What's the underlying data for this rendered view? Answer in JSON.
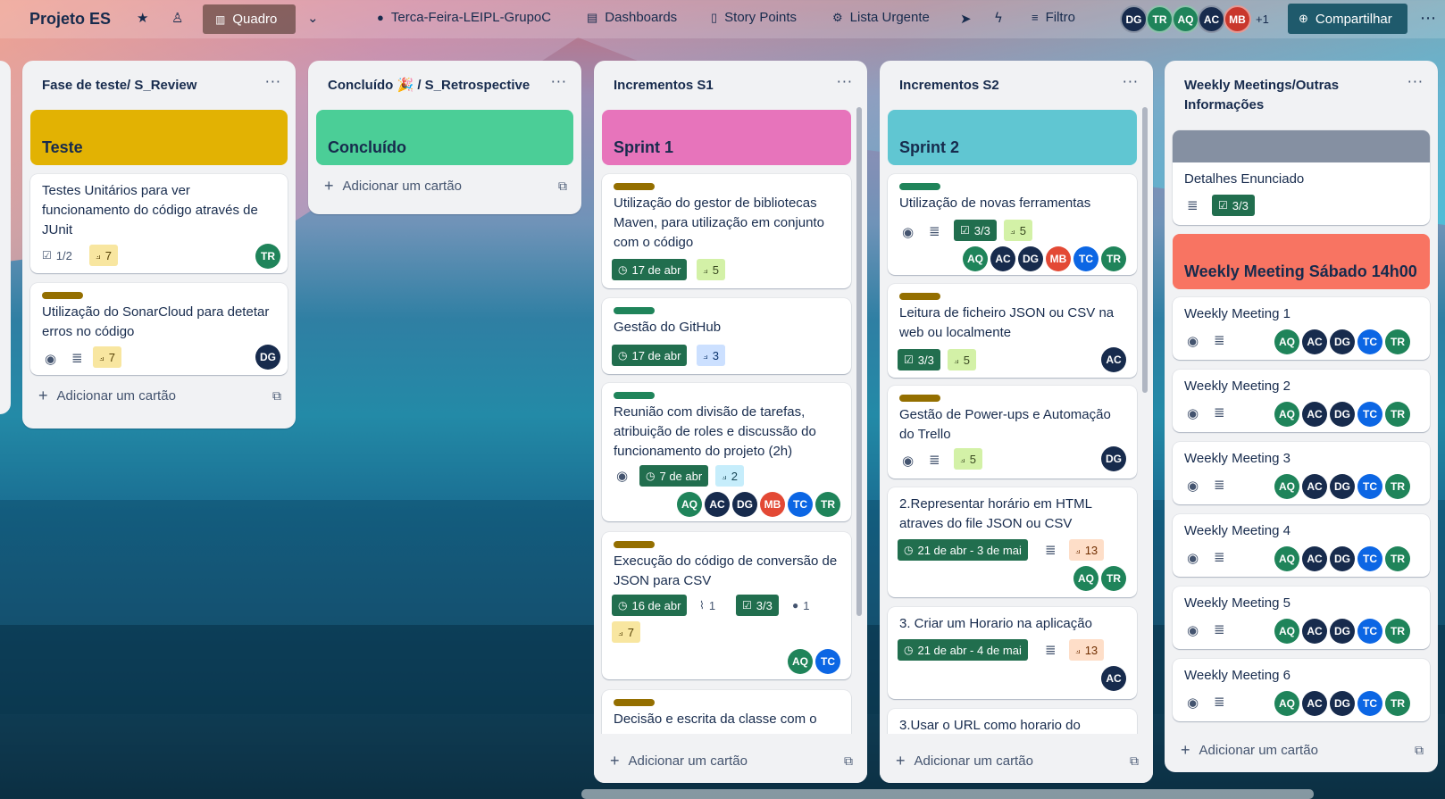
{
  "header": {
    "board_title": "Projeto ES",
    "view_label": "Quadro",
    "powerups": [
      {
        "label": "Terca-Feira-LEIPL-GrupoC",
        "icon": "github-icon"
      },
      {
        "label": "Dashboards",
        "icon": "dashboard-icon"
      },
      {
        "label": "Story Points",
        "icon": "story-points-icon"
      },
      {
        "label": "Lista Urgente",
        "icon": "gears-icon"
      }
    ],
    "filter_label": "Filtro",
    "members": [
      {
        "initials": "DG",
        "color": "#172b4d"
      },
      {
        "initials": "TR",
        "color": "#1f845a"
      },
      {
        "initials": "AQ",
        "color": "#1f845a"
      },
      {
        "initials": "AC",
        "color": "#172b4d"
      },
      {
        "initials": "MB",
        "color": "#c9372c"
      }
    ],
    "members_more": "+1",
    "share_label": "Compartilhar"
  },
  "colors": {
    "avatar_dark": "#172b4d",
    "avatar_green": "#1f845a",
    "avatar_red": "#e34935",
    "avatar_blue": "#0c66e4",
    "label_green": "#1f845a",
    "label_yellow": "#946f00"
  },
  "lists": [
    {
      "title": "Fase de teste/ S_Review",
      "add_label": "Adicionar um cartão",
      "cover": {
        "title": "Teste",
        "color": "#e2b203"
      },
      "cards": [
        {
          "title": "Testes Unitários para ver funcionamento do código através de JUnit",
          "checklist": "1/2",
          "points": "7",
          "members": [
            "TR"
          ]
        },
        {
          "title": "Utilização do SonarCloud para detetar erros no código",
          "label": "yellow",
          "points": "7",
          "members": [
            "DG"
          ]
        }
      ]
    },
    {
      "title": "Concluído 🎉 / S_Retrospective",
      "add_label": "Adicionar um cartão",
      "cover": {
        "title": "Concluído",
        "color": "#4bce97"
      }
    },
    {
      "title": "Incrementos S1",
      "add_label": "Adicionar um cartão",
      "cover": {
        "title": "Sprint 1",
        "color": "#e774bb"
      },
      "cards": [
        {
          "title": "Utilização do gestor de bibliotecas Maven, para utilização em conjunto com o código",
          "label": "yellow",
          "date": "17 de abr",
          "points": "5"
        },
        {
          "title": "Gestão do GitHub",
          "label": "green",
          "date": "17 de abr",
          "points": "3"
        },
        {
          "title": "Reunião com divisão de tarefas, atribuição de roles e discussão do funcionamento do projeto (2h)",
          "label": "green",
          "date": "7 de abr",
          "points": "2",
          "members": [
            "AQ",
            "AC",
            "DG",
            "MB",
            "TC",
            "TR"
          ]
        },
        {
          "title": "Execução do código de conversão de JSON para CSV",
          "label": "yellow",
          "date": "16 de abr",
          "attachments": "1",
          "checklist": "3/3",
          "github": "1",
          "points": "7",
          "members": [
            "AQ",
            "TC"
          ]
        },
        {
          "title": "Decisão e escrita da classe com o",
          "label": "yellow"
        }
      ]
    },
    {
      "title": "Incrementos S2",
      "add_label": "Adicionar um cartão",
      "cover": {
        "title": "Sprint 2",
        "color": "#60c6d2"
      },
      "cards": [
        {
          "title": "Utilização de novas ferramentas",
          "label": "green",
          "checklist": "3/3",
          "points": "5",
          "members": [
            "AQ",
            "AC",
            "DG",
            "MB",
            "TC",
            "TR"
          ]
        },
        {
          "title": "Leitura de ficheiro JSON ou CSV na web ou localmente",
          "label": "yellow",
          "checklist": "3/3",
          "points": "5",
          "members": [
            "AC"
          ]
        },
        {
          "title": "Gestão de Power-ups e Automação do Trello",
          "label": "yellow",
          "points": "5",
          "members": [
            "DG"
          ]
        },
        {
          "title": "2.Representar horário em HTML atraves do file JSON ou CSV",
          "date": "21 de abr - 3 de mai",
          "points": "13",
          "members": [
            "AQ",
            "TR"
          ]
        },
        {
          "title": "3. Criar um Horario na aplicação",
          "date": "21 de abr - 4 de mai",
          "points": "13",
          "members": [
            "AC"
          ]
        },
        {
          "title": "3.Usar o URL como horario do"
        }
      ]
    },
    {
      "title": "Weekly Meetings/Outras Informações",
      "add_label": "Adicionar um cartão",
      "cards": [
        {
          "title": "Detalhes Enunciado",
          "cover_color": "#8590a2",
          "checklist": "3/3"
        },
        {
          "title": "Weekly Meeting Sábado 14h00",
          "cover_color": "#f87462"
        },
        {
          "title": "Weekly Meeting 1",
          "members": [
            "AQ",
            "AC",
            "DG",
            "TC",
            "TR"
          ]
        },
        {
          "title": "Weekly Meeting 2",
          "members": [
            "AQ",
            "AC",
            "DG",
            "TC",
            "TR"
          ]
        },
        {
          "title": "Weekly Meeting 3",
          "members": [
            "AQ",
            "AC",
            "DG",
            "TC",
            "TR"
          ]
        },
        {
          "title": "Weekly Meeting 4",
          "members": [
            "AQ",
            "AC",
            "DG",
            "TC",
            "TR"
          ]
        },
        {
          "title": "Weekly Meeting 5",
          "members": [
            "AQ",
            "AC",
            "DG",
            "TC",
            "TR"
          ]
        },
        {
          "title": "Weekly Meeting 6",
          "members": [
            "AQ",
            "AC",
            "DG",
            "TC",
            "TR"
          ]
        }
      ]
    }
  ]
}
